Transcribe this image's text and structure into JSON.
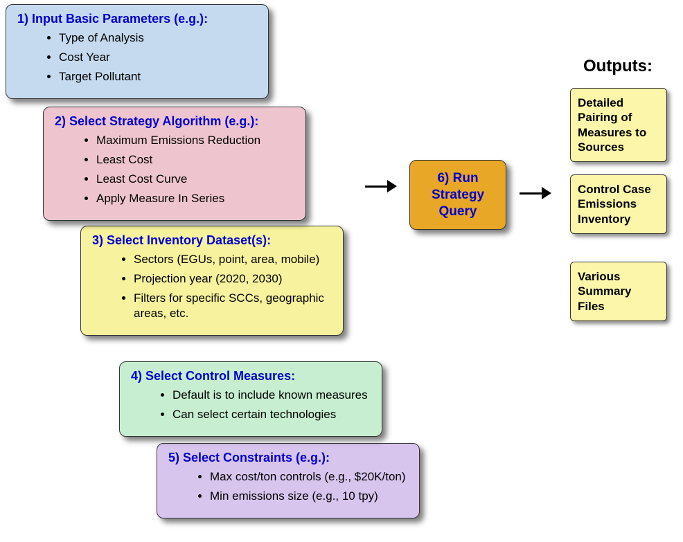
{
  "steps": [
    {
      "title": "1) Input Basic Parameters (e.g.):",
      "items": [
        "Type of Analysis",
        "Cost Year",
        "Target Pollutant"
      ]
    },
    {
      "title": "2) Select Strategy Algorithm (e.g.):",
      "items": [
        "Maximum Emissions Reduction",
        "Least Cost",
        "Least Cost Curve",
        "Apply Measure In Series"
      ]
    },
    {
      "title": "3) Select Inventory Dataset(s):",
      "items": [
        "Sectors (EGUs, point, area, mobile)",
        "Projection year (2020, 2030)",
        "Filters for specific SCCs, geographic areas, etc."
      ]
    },
    {
      "title": "4) Select Control Measures:",
      "items": [
        "Default is to include known measures",
        "Can select certain technologies"
      ]
    },
    {
      "title": "5) Select Constraints (e.g.):",
      "items": [
        "Max cost/ton controls (e.g., $20K/ton)",
        "Min emissions size (e.g., 10 tpy)"
      ]
    }
  ],
  "run": {
    "title": "6) Run Strategy Query"
  },
  "outputs_label": "Outputs:",
  "outputs": [
    "Detailed Pairing of Measures to Sources",
    "Control Case Emissions Inventory",
    "Various Summary Files"
  ]
}
